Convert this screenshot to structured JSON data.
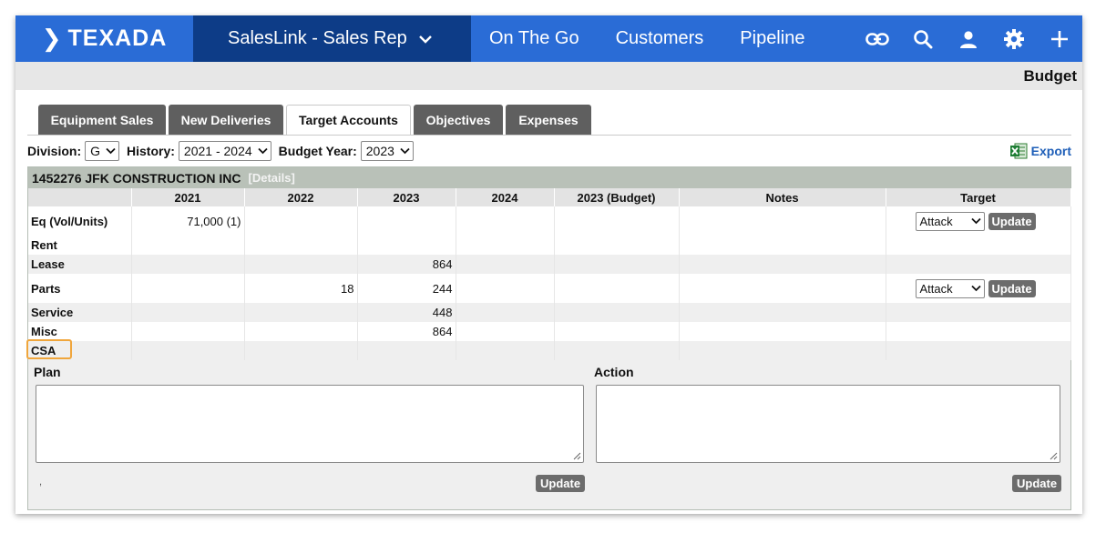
{
  "brand": {
    "name": "TEXADA"
  },
  "nav": {
    "app_switcher": "SalesLink - Sales Rep",
    "links": [
      "On The Go",
      "Customers",
      "Pipeline"
    ]
  },
  "page": {
    "title": "Budget"
  },
  "tabs": [
    {
      "label": "Equipment Sales",
      "active": false
    },
    {
      "label": "New Deliveries",
      "active": false
    },
    {
      "label": "Target Accounts",
      "active": true
    },
    {
      "label": "Objectives",
      "active": false
    },
    {
      "label": "Expenses",
      "active": false
    }
  ],
  "filters": {
    "division_label": "Division:",
    "division_value": "G",
    "history_label": "History:",
    "history_value": "2021 - 2024",
    "budget_year_label": "Budget Year:",
    "budget_year_value": "2023",
    "export_label": "Export"
  },
  "account": {
    "header": "1452276 JFK CONSTRUCTION INC",
    "details_link": "[Details]",
    "columns": [
      "",
      "2021",
      "2022",
      "2023",
      "2024",
      "2023 (Budget)",
      "Notes",
      "Target"
    ],
    "rows": [
      {
        "label": "Eq (Vol/Units)",
        "y2021": "71,000 (1)",
        "y2022": "",
        "y2023": "",
        "y2024": "",
        "budget": "",
        "notes": "",
        "target": "Attack",
        "has_update": true
      },
      {
        "label": "Rent",
        "y2021": "",
        "y2022": "",
        "y2023": "",
        "y2024": "",
        "budget": "",
        "notes": "",
        "target": "",
        "has_update": false
      },
      {
        "label": "Lease",
        "y2021": "",
        "y2022": "",
        "y2023": "864",
        "y2024": "",
        "budget": "",
        "notes": "",
        "target": "",
        "has_update": false
      },
      {
        "label": "Parts",
        "y2021": "",
        "y2022": "18",
        "y2023": "244",
        "y2024": "",
        "budget": "",
        "notes": "",
        "target": "Attack",
        "has_update": true
      },
      {
        "label": "Service",
        "y2021": "",
        "y2022": "",
        "y2023": "448",
        "y2024": "",
        "budget": "",
        "notes": "",
        "target": "",
        "has_update": false
      },
      {
        "label": "Misc",
        "y2021": "",
        "y2022": "",
        "y2023": "864",
        "y2024": "",
        "budget": "",
        "notes": "",
        "target": "",
        "has_update": false
      },
      {
        "label": "CSA",
        "y2021": "",
        "y2022": "",
        "y2023": "",
        "y2024": "",
        "budget": "",
        "notes": "",
        "target": "",
        "has_update": false
      }
    ],
    "update_label": "Update"
  },
  "plan": {
    "label": "Plan",
    "value": "",
    "update_label": "Update",
    "footnote": ","
  },
  "action": {
    "label": "Action",
    "value": "",
    "update_label": "Update"
  },
  "colors": {
    "nav_blue": "#2a6cd6",
    "nav_dark": "#0d3c87",
    "highlight": "#f0a63c"
  }
}
